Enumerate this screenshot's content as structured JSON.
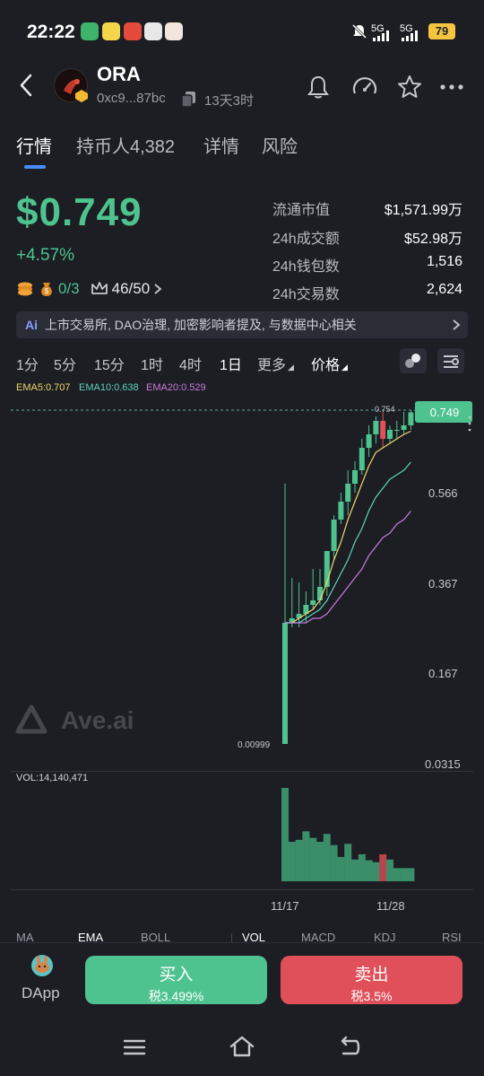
{
  "status_bar": {
    "time": "22:22",
    "signal1": "5G",
    "signal2": "5G",
    "battery": "79"
  },
  "header": {
    "token_name": "ORA",
    "address": "0xc9...87bc",
    "age": "13天3时"
  },
  "tabs": [
    {
      "label": "行情",
      "active": true
    },
    {
      "label": "持币人4,382",
      "active": false
    },
    {
      "label": "详情",
      "active": false
    },
    {
      "label": "风险",
      "active": false
    }
  ],
  "price": {
    "value": "$0.749",
    "change": "+4.57%"
  },
  "badges": {
    "ratio_a": "0/3",
    "ratio_b": "46/50"
  },
  "stats": [
    {
      "label": "流通市值",
      "value": "$1,571.99万"
    },
    {
      "label": "24h成交额",
      "value": "$52.98万"
    },
    {
      "label": "24h钱包数",
      "value": "1,516"
    },
    {
      "label": "24h交易数",
      "value": "2,624"
    }
  ],
  "ai_summary": "上市交易所, DAO治理, 加密影响者提及, 与数据中心相关",
  "ai_tag": "Ai",
  "timeframes": [
    "1分",
    "5分",
    "15分",
    "1时",
    "4时",
    "1日",
    "更多"
  ],
  "price_selector": "价格",
  "active_timeframe": "1日",
  "ema": {
    "ema5": "EMA5:0.707",
    "ema10": "EMA10:0.638",
    "ema20": "EMA20:0.529"
  },
  "chart_labels": {
    "current_price": "0.749",
    "high": "0.754",
    "low": "0.00999",
    "ticks": [
      "0.566",
      "0.367",
      "0.167",
      "0.0315"
    ],
    "watermark": "Ave.ai"
  },
  "volume": {
    "label": "VOL:14,140,471"
  },
  "dates": [
    "11/17",
    "11/28"
  ],
  "indicators": [
    "MA",
    "EMA",
    "BOLL",
    "VOL",
    "MACD",
    "KDJ",
    "RSI"
  ],
  "actions": {
    "dapp": "DApp",
    "buy": "买入",
    "buy_tax": "税3.499%",
    "sell": "卖出",
    "sell_tax": "税3.5%"
  },
  "colors": {
    "up": "#4ec38f",
    "down": "#e0505a",
    "accent": "#4a8cff"
  },
  "chart_data": {
    "type": "candlestick",
    "ylim": [
      0.0315,
      0.754
    ],
    "candles": [
      {
        "o": 0.01,
        "h": 0.59,
        "l": 0.01,
        "c": 0.28
      },
      {
        "o": 0.28,
        "h": 0.38,
        "l": 0.27,
        "c": 0.29
      },
      {
        "o": 0.29,
        "h": 0.37,
        "l": 0.27,
        "c": 0.3
      },
      {
        "o": 0.3,
        "h": 0.35,
        "l": 0.28,
        "c": 0.32
      },
      {
        "o": 0.32,
        "h": 0.4,
        "l": 0.31,
        "c": 0.33
      },
      {
        "o": 0.33,
        "h": 0.4,
        "l": 0.32,
        "c": 0.36
      },
      {
        "o": 0.36,
        "h": 0.44,
        "l": 0.34,
        "c": 0.44
      },
      {
        "o": 0.44,
        "h": 0.52,
        "l": 0.42,
        "c": 0.51
      },
      {
        "o": 0.51,
        "h": 0.57,
        "l": 0.5,
        "c": 0.55
      },
      {
        "o": 0.55,
        "h": 0.62,
        "l": 0.52,
        "c": 0.59
      },
      {
        "o": 0.59,
        "h": 0.64,
        "l": 0.57,
        "c": 0.62
      },
      {
        "o": 0.62,
        "h": 0.69,
        "l": 0.61,
        "c": 0.67
      },
      {
        "o": 0.67,
        "h": 0.72,
        "l": 0.65,
        "c": 0.7
      },
      {
        "o": 0.7,
        "h": 0.74,
        "l": 0.68,
        "c": 0.73
      },
      {
        "o": 0.73,
        "h": 0.75,
        "l": 0.67,
        "c": 0.69
      },
      {
        "o": 0.69,
        "h": 0.72,
        "l": 0.68,
        "c": 0.71
      },
      {
        "o": 0.71,
        "h": 0.73,
        "l": 0.69,
        "c": 0.71
      },
      {
        "o": 0.71,
        "h": 0.75,
        "l": 0.7,
        "c": 0.72
      },
      {
        "o": 0.72,
        "h": 0.754,
        "l": 0.71,
        "c": 0.749
      }
    ],
    "ema5": [
      0.28,
      0.28,
      0.29,
      0.3,
      0.31,
      0.33,
      0.37,
      0.42,
      0.46,
      0.51,
      0.55,
      0.59,
      0.63,
      0.66,
      0.67,
      0.68,
      0.69,
      0.7,
      0.707
    ],
    "ema10": [
      0.28,
      0.28,
      0.28,
      0.29,
      0.3,
      0.31,
      0.33,
      0.36,
      0.39,
      0.42,
      0.46,
      0.49,
      0.53,
      0.56,
      0.58,
      0.6,
      0.61,
      0.62,
      0.638
    ],
    "ema20": [
      0.28,
      0.28,
      0.28,
      0.28,
      0.29,
      0.29,
      0.3,
      0.32,
      0.34,
      0.36,
      0.38,
      0.4,
      0.43,
      0.45,
      0.47,
      0.48,
      0.5,
      0.51,
      0.529
    ],
    "volume": [
      14.2,
      6.0,
      6.3,
      7.6,
      6.6,
      6.0,
      7.2,
      5.5,
      3.7,
      5.7,
      3.3,
      4.1,
      3.2,
      2.9,
      4.1,
      3.3,
      2.0,
      2.0,
      2.0
    ]
  }
}
